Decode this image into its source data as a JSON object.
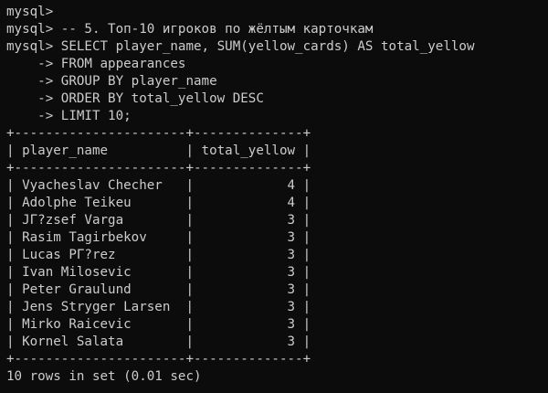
{
  "terminal": {
    "lines": [
      "mysql>",
      "mysql> -- 5. Топ-10 игроков по жёлтым карточкам",
      "mysql> SELECT player_name, SUM(yellow_cards) AS total_yellow",
      "    -> FROM appearances",
      "    -> GROUP BY player_name",
      "    -> ORDER BY total_yellow DESC",
      "    -> LIMIT 10;",
      "+----------------------+--------------+",
      "| player_name          | total_yellow |",
      "+----------------------+--------------+",
      "| Vyacheslav Checher   |            4 |",
      "| Adolphe Teikeu       |            4 |",
      "| JΓ?zsef Varga        |            3 |",
      "| Rasim Tagirbekov     |            3 |",
      "| Lucas PΓ?rez         |            3 |",
      "| Ivan Milosevic       |            3 |",
      "| Peter Graulund       |            3 |",
      "| Jens Stryger Larsen  |            3 |",
      "| Mirko Raicevic       |            3 |",
      "| Kornel Salata        |            3 |",
      "+----------------------+--------------+",
      "10 rows in set (0.01 sec)"
    ]
  },
  "colors": {
    "background": "#0c0c0c",
    "foreground": "#cccccc"
  }
}
